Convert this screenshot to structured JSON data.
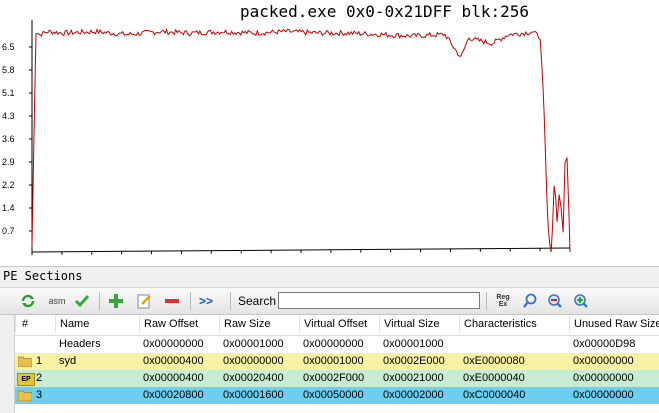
{
  "chart": {
    "title": "packed.exe 0x0-0x21DFF blk:256",
    "y_ticks": [
      "6.5",
      "5.8",
      "5.1",
      "4.3",
      "3.6",
      "2.9",
      "2.2",
      "1.4",
      "0.7"
    ]
  },
  "chart_data": {
    "type": "line",
    "title": "packed.exe 0x0-0x21DFF blk:256",
    "xlabel": "",
    "ylabel": "",
    "ylim": [
      0,
      8
    ],
    "x_range": [
      0,
      138751
    ],
    "series_color": "#c00000",
    "series": [
      {
        "x": [
          0,
          1024,
          2048,
          4096,
          8192,
          16384,
          24576,
          32768,
          40960,
          49152,
          57344,
          65536,
          73728,
          81920,
          90112,
          98304,
          106496,
          110592,
          112640,
          114688,
          118784,
          122880,
          126976,
          129024,
          131072,
          132096,
          133120,
          133888,
          134656,
          135424,
          135936,
          136448,
          136960,
          137472,
          137984,
          138496,
          138751
        ],
        "values": [
          0.2,
          7.6,
          7.5,
          7.6,
          7.55,
          7.6,
          7.5,
          7.6,
          7.55,
          7.6,
          7.55,
          7.6,
          7.55,
          7.55,
          7.5,
          7.45,
          7.5,
          6.7,
          7.4,
          7.3,
          7.2,
          7.5,
          7.55,
          7.6,
          7.4,
          4.5,
          0.6,
          0.0,
          2.4,
          1.3,
          1.9,
          1.6,
          0.8,
          2.8,
          3.2,
          1.5,
          0.0
        ]
      }
    ]
  },
  "panel": {
    "title": "PE Sections",
    "search_label": "Search",
    "search_value": ""
  },
  "toolbar": {
    "icons": [
      "refresh-icon",
      "asm-icon",
      "check-icon",
      "add-icon",
      "edit-icon",
      "remove-icon",
      "forward-icon",
      "regex-icon",
      "find-icon",
      "find-previous-icon",
      "find-next-icon"
    ],
    "asm_label": "asm",
    "forward_label": ">>",
    "regex_label": "Reg Ex"
  },
  "table": {
    "columns": [
      "#",
      "Name",
      "Raw Offset",
      "Raw Size",
      "Virtual Offset",
      "Virtual Size",
      "Characteristics",
      "Unused Raw Size"
    ],
    "rows": [
      {
        "num": "",
        "name": "Headers",
        "raw_offset": "0x00000000",
        "raw_size": "0x00001000",
        "virtual_offset": "0x00000000",
        "virtual_size": "0x00001000",
        "characteristics": "",
        "unused_raw_size": "0x00000D98",
        "icon": "",
        "bg": "#ffffff"
      },
      {
        "num": "1",
        "name": "syd",
        "raw_offset": "0x00000400",
        "raw_size": "0x00000000",
        "virtual_offset": "0x00001000",
        "virtual_size": "0x0002E000",
        "characteristics": "0xE0000080",
        "unused_raw_size": "0x00000000",
        "icon": "folder-icon",
        "bg": "#f8f1a4"
      },
      {
        "num": "2",
        "name": "",
        "raw_offset": "0x00000400",
        "raw_size": "0x00020400",
        "virtual_offset": "0x0002F000",
        "virtual_size": "0x00021000",
        "characteristics": "0xE0000040",
        "unused_raw_size": "0x00000000",
        "icon": "entry-point-icon",
        "icon_label": "EP",
        "bg": "#c8ecd3"
      },
      {
        "num": "3",
        "name": "",
        "raw_offset": "0x00020800",
        "raw_size": "0x00001600",
        "virtual_offset": "0x00050000",
        "virtual_size": "0x00002000",
        "characteristics": "0xC0000040",
        "unused_raw_size": "0x00000000",
        "icon": "folder-icon",
        "bg": "#6ccff2"
      }
    ]
  }
}
